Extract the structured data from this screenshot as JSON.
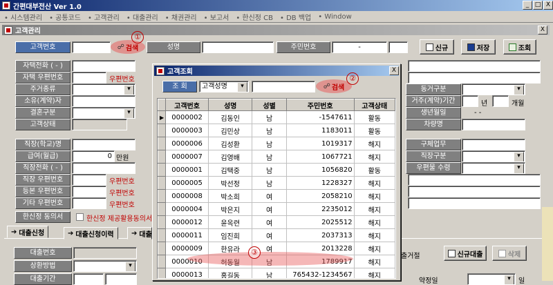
{
  "app": {
    "title": "간편대부전산 Ver 1.0",
    "window_controls": [
      "_",
      "□",
      "X"
    ]
  },
  "menu": [
    "시스템관리",
    "공통코드",
    "고객관리",
    "대출관리",
    "채권관리",
    "보고서",
    "한신정 CB",
    "DB 백업",
    "Window"
  ],
  "child": {
    "title": "고객관리",
    "close": "X"
  },
  "search_row": {
    "cust_no_label": "고객번호",
    "search_label": "검색",
    "name_label": "성명",
    "rrn_label": "주민번호",
    "rrn_dash": "-",
    "btn_new": "신규",
    "btn_save": "저장",
    "btn_query": "조회"
  },
  "left_form": [
    {
      "label": "자택전화 ( - )",
      "suffix": ""
    },
    {
      "label": "자택 우편번호",
      "suffix": "우편번호"
    },
    {
      "label": "주거종류",
      "suffix": "",
      "combo": true
    },
    {
      "label": "소유(계약)자",
      "suffix": ""
    },
    {
      "label": "결혼구분",
      "suffix": "",
      "combo": true
    },
    {
      "label": "고객상태",
      "suffix": ""
    }
  ],
  "left_form2": [
    {
      "label": "직장(학교)명",
      "value": ""
    },
    {
      "label": "급여(월급)",
      "value": "0",
      "unit": "만원"
    },
    {
      "label": "직장전화 ( - )",
      "value": ""
    },
    {
      "label": "직장 우편번호",
      "suffix": "우편번호"
    },
    {
      "label": "등본 우편번호",
      "suffix": "우편번호"
    },
    {
      "label": "기타 우편번호",
      "suffix": "우편번호"
    }
  ],
  "agree_row": {
    "label": "한신정 동의서",
    "text": "한신정 제공활용동의서"
  },
  "right_form": {
    "move_type": "동거구분",
    "period": "거주(계약)기간",
    "year": "년",
    "month": "개월",
    "birthday": "생년월일",
    "birthday_value": "- -",
    "car": "차량명",
    "job": "구체업무",
    "job_type": "직장구분",
    "mail_recv": "우편물 수령"
  },
  "tabs": [
    "대출신청",
    "대출신청이력",
    "대출"
  ],
  "loan": {
    "loan_no_label": "대출번호",
    "repay_label": "상환방법",
    "period_label": "대출기간",
    "reject_label": "출거절",
    "btn_new_loan": "신규대출",
    "btn_delete": "삭제",
    "fee_label": "약정일",
    "fee_unit": "일"
  },
  "dialog": {
    "title": "고객조회",
    "close": "X",
    "query_label": "조 회",
    "filter_select": "고객성명",
    "search_label": "검색",
    "columns": [
      "고객번호",
      "성명",
      "성별",
      "주민번호",
      "고객상태"
    ],
    "rows": [
      {
        "no": "0000002",
        "name": "김동인",
        "sex": "남",
        "rrn": "-1547611",
        "status": "활동"
      },
      {
        "no": "0000003",
        "name": "김민상",
        "sex": "남",
        "rrn": "1183011",
        "status": "활동"
      },
      {
        "no": "0000006",
        "name": "김성환",
        "sex": "남",
        "rrn": "1019317",
        "status": "해지"
      },
      {
        "no": "0000007",
        "name": "김영배",
        "sex": "남",
        "rrn": "1067721",
        "status": "해지"
      },
      {
        "no": "0000001",
        "name": "김택중",
        "sex": "남",
        "rrn": "1056820",
        "status": "활동"
      },
      {
        "no": "0000005",
        "name": "박선정",
        "sex": "남",
        "rrn": "1228327",
        "status": "해지"
      },
      {
        "no": "0000008",
        "name": "박소희",
        "sex": "여",
        "rrn": "2058210",
        "status": "해지"
      },
      {
        "no": "0000004",
        "name": "박은지",
        "sex": "여",
        "rrn": "2235012",
        "status": "해지"
      },
      {
        "no": "0000012",
        "name": "윤옥련",
        "sex": "여",
        "rrn": "2025512",
        "status": "해지"
      },
      {
        "no": "0000011",
        "name": "임진희",
        "sex": "여",
        "rrn": "2037313",
        "status": "해지"
      },
      {
        "no": "0000009",
        "name": "한유라",
        "sex": "여",
        "rrn": "2013228",
        "status": "해지"
      },
      {
        "no": "0000010",
        "name": "허동월",
        "sex": "남",
        "rrn": "1789917",
        "status": "해지"
      },
      {
        "no": "0000013",
        "name": "홍길동",
        "sex": "남",
        "rrn": "765432-1234567",
        "status": "해지"
      }
    ]
  },
  "callouts": [
    "①",
    "②",
    "③"
  ],
  "colors": {
    "title_gradient_start": "#0a246a",
    "title_gradient_end": "#a6caf0",
    "label_gray": "#808080",
    "label_blue": "#4a6ea8",
    "accent_red": "#c00000",
    "highlight": "#e86060"
  }
}
